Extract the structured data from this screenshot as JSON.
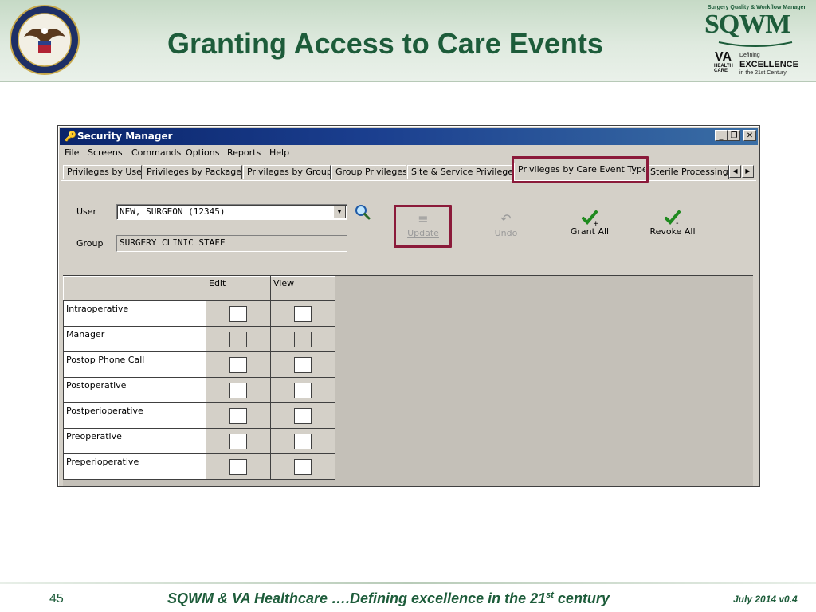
{
  "slide": {
    "title": "Granting Access to Care Events",
    "logo": {
      "tagline": "Surgery Quality & Workflow Manager",
      "name": "SQWM",
      "va": "VA",
      "va_sub": "HEALTH CARE",
      "defining": "Defining",
      "excellence": "EXCELLENCE",
      "century": "in the 21st Century"
    },
    "seal_icon": "va-department-seal-icon",
    "footer": {
      "page_number": "45",
      "text_main": "SQWM & VA Healthcare ….Defining excellence in the 21",
      "text_sup": "st",
      "text_end": " century",
      "date": "July 2014 v0.4"
    },
    "highlight_color": "#8b1a3a",
    "title_color": "#1d5c3a"
  },
  "window": {
    "title": "Security Manager",
    "title_icon": "key-icon",
    "controls": {
      "minimize": "_",
      "restore": "❐",
      "close": "✕"
    },
    "menu": [
      "File",
      "Screens",
      "Commands",
      "Options",
      "Reports",
      "Help"
    ],
    "tabs": [
      {
        "label": "Privileges by User"
      },
      {
        "label": "Privileges by Package"
      },
      {
        "label": "Privileges by Group"
      },
      {
        "label": "Group Privileges"
      },
      {
        "label": "Site & Service Privileges"
      },
      {
        "label": "Privileges by Care Event Type"
      },
      {
        "label": "Sterile Processing M"
      }
    ],
    "active_tab": "Privileges by Care Event Type",
    "user": {
      "label": "User",
      "value": "NEW, SURGEON   (12345)"
    },
    "group": {
      "label": "Group",
      "value": "SURGERY CLINIC STAFF"
    },
    "toolbar": {
      "update": {
        "label": "Update",
        "icon": "update-icon",
        "enabled": false
      },
      "undo": {
        "label": "Undo",
        "icon": "undo-icon",
        "enabled": false
      },
      "grant_all": {
        "label": "Grant All",
        "icon": "grant-all-check-plus-icon",
        "enabled": true
      },
      "revoke_all": {
        "label": "Revoke All",
        "icon": "revoke-all-check-minus-icon",
        "enabled": true
      }
    },
    "grid": {
      "columns": [
        "Edit",
        "View"
      ],
      "rows": [
        {
          "label": "Intraoperative",
          "edit": false,
          "view": false,
          "disabled": false
        },
        {
          "label": "Manager",
          "edit": false,
          "view": false,
          "disabled": true
        },
        {
          "label": "Postop Phone Call",
          "edit": false,
          "view": false,
          "disabled": false
        },
        {
          "label": "Postoperative",
          "edit": false,
          "view": false,
          "disabled": false
        },
        {
          "label": "Postperioperative",
          "edit": false,
          "view": false,
          "disabled": false
        },
        {
          "label": "Preoperative",
          "edit": false,
          "view": false,
          "disabled": false
        },
        {
          "label": "Preperioperative",
          "edit": false,
          "view": false,
          "disabled": false
        }
      ]
    }
  }
}
